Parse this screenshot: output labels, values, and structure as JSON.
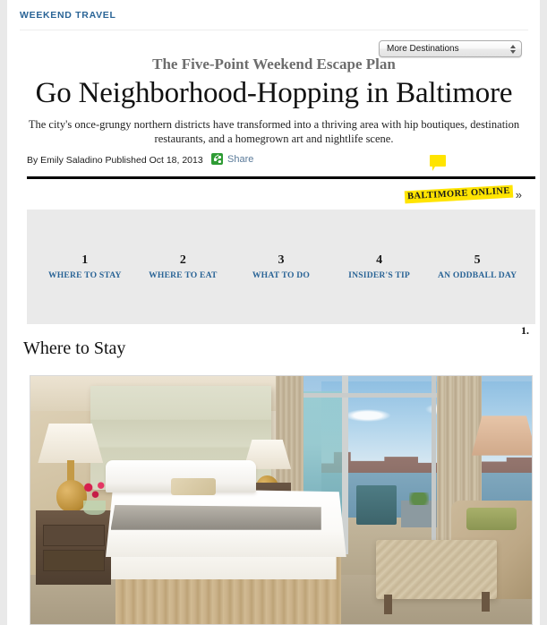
{
  "kicker": "WEEKEND TRAVEL",
  "destination_select": {
    "value": "More Destinations",
    "options": [
      "More Destinations"
    ]
  },
  "article": {
    "series_title": "The Five-Point Weekend Escape Plan",
    "headline": "Go Neighborhood-Hopping in Baltimore",
    "deck": "The city's once-grungy northern districts have transformed into a thriving area with hip boutiques, destination restaurants, and a homegrown art and nightlife scene.",
    "byline": "By Emily Saladino  Published Oct 18, 2013",
    "share_label": "Share"
  },
  "online_tag": {
    "label": "BALTIMORE ONLINE",
    "chevron": "»",
    "highlight_color": "#ffe400"
  },
  "five_point_nav": [
    {
      "number": "1",
      "label": "WHERE TO STAY"
    },
    {
      "number": "2",
      "label": "WHERE TO EAT"
    },
    {
      "number": "3",
      "label": "WHAT TO DO"
    },
    {
      "number": "4",
      "label": "INSIDER'S TIP"
    },
    {
      "number": "5",
      "label": "AN ODDBALL DAY"
    }
  ],
  "section": {
    "number": "1.",
    "heading": "Where to Stay"
  },
  "colors": {
    "kicker_blue": "#2a6496",
    "nav_label_blue": "#2a6496",
    "panel_gray": "#eaeaea",
    "share_green": "#2e9b34",
    "page_background": "#e9e9e9"
  }
}
